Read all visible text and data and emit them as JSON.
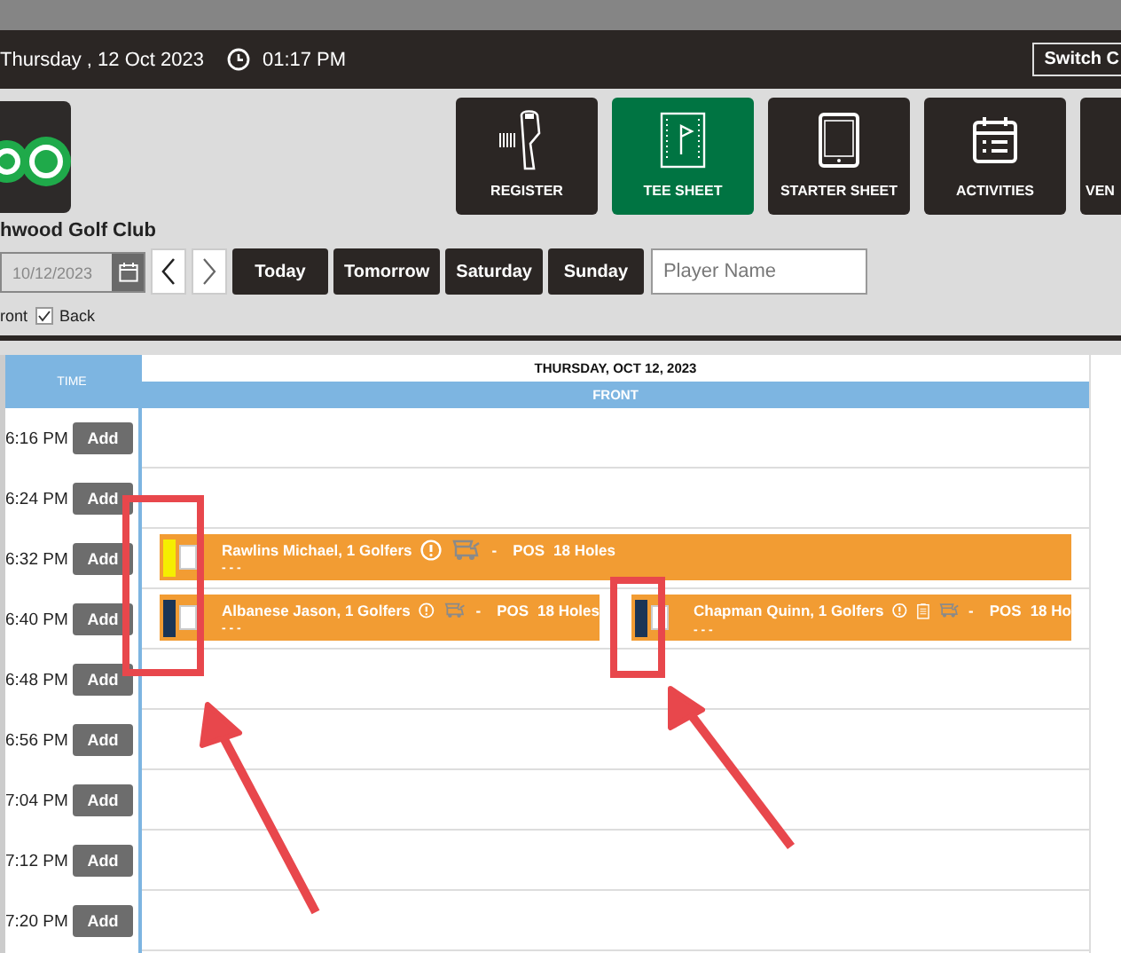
{
  "header": {
    "date": "Thursday ,  12 Oct 2023",
    "time": "01:17 PM",
    "switch_button": "Switch C"
  },
  "club": {
    "name": "hwood Golf Club"
  },
  "nav": [
    {
      "label": "REGISTER",
      "kind": "scanner",
      "selected": false
    },
    {
      "label": "TEE SHEET",
      "kind": "flag",
      "selected": true
    },
    {
      "label": "STARTER SHEET",
      "kind": "tablet",
      "selected": false
    },
    {
      "label": "ACTIVITIES",
      "kind": "calendar",
      "selected": false
    },
    {
      "label": "VEN",
      "kind": "cut",
      "selected": false
    }
  ],
  "date_field": {
    "value": "10/12/2023"
  },
  "quick_dates": [
    "Today",
    "Tomorrow",
    "Saturday",
    "Sunday"
  ],
  "player_search": {
    "placeholder": "Player Name"
  },
  "course_filter": {
    "front_label": "ront",
    "back": {
      "label": "Back",
      "checked": true
    }
  },
  "sheet": {
    "time_header": "TIME",
    "date_header": "THURSDAY, OCT 12, 2023",
    "course_header": "FRONT",
    "rows": [
      {
        "time": "6:16 PM",
        "add": "Add"
      },
      {
        "time": "6:24 PM",
        "add": "Add"
      },
      {
        "time": "6:32 PM",
        "add": "Add",
        "bookings": [
          {
            "color": "#f5ee00",
            "selected": false,
            "name": "Rawlins Michael, 1 Golfers",
            "note": false,
            "cart": "-",
            "payment": "POS",
            "holes": "18 Holes",
            "detail": "- - -"
          }
        ]
      },
      {
        "time": "6:40 PM",
        "add": "Add",
        "bookings": [
          {
            "color": "#1b3556",
            "selected": false,
            "name": "Albanese Jason, 1 Golfers",
            "note": false,
            "cart": "-",
            "payment": "POS",
            "holes": "18 Holes",
            "detail": "- - -"
          },
          {
            "color": "#1b3556",
            "selected": false,
            "name": "Chapman Quinn, 1 Golfers",
            "note": true,
            "cart": "-",
            "payment": "POS",
            "holes": "18 Ho",
            "detail": "- - -"
          }
        ]
      },
      {
        "time": "6:48 PM",
        "add": "Add"
      },
      {
        "time": "6:56 PM",
        "add": "Add"
      },
      {
        "time": "7:04 PM",
        "add": "Add"
      },
      {
        "time": "7:12 PM",
        "add": "Add"
      },
      {
        "time": "7:20 PM",
        "add": "Add"
      }
    ]
  }
}
